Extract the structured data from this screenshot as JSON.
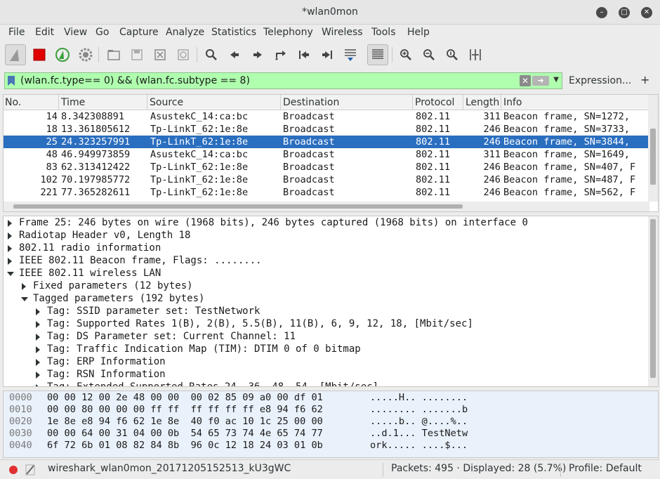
{
  "window": {
    "title": "*wlan0mon"
  },
  "menu": [
    "File",
    "Edit",
    "View",
    "Go",
    "Capture",
    "Analyze",
    "Statistics",
    "Telephony",
    "Wireless",
    "Tools",
    "Help"
  ],
  "filter": {
    "value": "(wlan.fc.type== 0) && (wlan.fc.subtype == 8)",
    "expression_label": "Expression...",
    "add_label": "+"
  },
  "packet_list": {
    "columns": [
      "No.",
      "Time",
      "Source",
      "Destination",
      "Protocol",
      "Length",
      "Info"
    ],
    "rows": [
      {
        "no": "14",
        "time": "8.342308891",
        "source": "AsustekC_14:ca:bc",
        "destination": "Broadcast",
        "protocol": "802.11",
        "length": "311",
        "info": "Beacon frame, SN=1272,",
        "selected": false
      },
      {
        "no": "18",
        "time": "13.361805612",
        "source": "Tp-LinkT_62:1e:8e",
        "destination": "Broadcast",
        "protocol": "802.11",
        "length": "246",
        "info": "Beacon frame, SN=3733,",
        "selected": false
      },
      {
        "no": "25",
        "time": "24.323257991",
        "source": "Tp-LinkT_62:1e:8e",
        "destination": "Broadcast",
        "protocol": "802.11",
        "length": "246",
        "info": "Beacon frame, SN=3844,",
        "selected": true
      },
      {
        "no": "48",
        "time": "46.949973859",
        "source": "AsustekC_14:ca:bc",
        "destination": "Broadcast",
        "protocol": "802.11",
        "length": "311",
        "info": "Beacon frame, SN=1649,",
        "selected": false
      },
      {
        "no": "83",
        "time": "62.313412422",
        "source": "Tp-LinkT_62:1e:8e",
        "destination": "Broadcast",
        "protocol": "802.11",
        "length": "246",
        "info": "Beacon frame, SN=407, F",
        "selected": false
      },
      {
        "no": "102",
        "time": "70.197985772",
        "source": "Tp-LinkT_62:1e:8e",
        "destination": "Broadcast",
        "protocol": "802.11",
        "length": "246",
        "info": "Beacon frame, SN=487, F",
        "selected": false
      },
      {
        "no": "221",
        "time": "77.365282611",
        "source": "Tp-LinkT_62:1e:8e",
        "destination": "Broadcast",
        "protocol": "802.11",
        "length": "246",
        "info": "Beacon frame, SN=562, F",
        "selected": false
      }
    ]
  },
  "details": [
    {
      "text": "Frame 25: 246 bytes on wire (1968 bits), 246 bytes captured (1968 bits) on interface 0",
      "level": 0,
      "expanded": false
    },
    {
      "text": "Radiotap Header v0, Length 18",
      "level": 0,
      "expanded": false
    },
    {
      "text": "802.11 radio information",
      "level": 0,
      "expanded": false
    },
    {
      "text": "IEEE 802.11 Beacon frame, Flags: ........",
      "level": 0,
      "expanded": false
    },
    {
      "text": "IEEE 802.11 wireless LAN",
      "level": 0,
      "expanded": true
    },
    {
      "text": "Fixed parameters (12 bytes)",
      "level": 1,
      "expanded": false
    },
    {
      "text": "Tagged parameters (192 bytes)",
      "level": 1,
      "expanded": true
    },
    {
      "text": "Tag: SSID parameter set: TestNetwork",
      "level": 2,
      "expanded": false
    },
    {
      "text": "Tag: Supported Rates 1(B), 2(B), 5.5(B), 11(B), 6, 9, 12, 18, [Mbit/sec]",
      "level": 2,
      "expanded": false
    },
    {
      "text": "Tag: DS Parameter set: Current Channel: 11",
      "level": 2,
      "expanded": false
    },
    {
      "text": "Tag: Traffic Indication Map (TIM): DTIM 0 of 0 bitmap",
      "level": 2,
      "expanded": false
    },
    {
      "text": "Tag: ERP Information",
      "level": 2,
      "expanded": false
    },
    {
      "text": "Tag: RSN Information",
      "level": 2,
      "expanded": false
    },
    {
      "text": "Tag: Extended Supported Rates 24, 36, 48, 54, [Mbit/sec]",
      "level": 2,
      "expanded": false
    }
  ],
  "hex": [
    {
      "offset": "0000",
      "bytes": "00 00 12 00 2e 48 00 00  00 02 85 09 a0 00 df 01",
      "ascii": ".....H.. ........"
    },
    {
      "offset": "0010",
      "bytes": "00 00 80 00 00 00 ff ff  ff ff ff ff e8 94 f6 62",
      "ascii": "........ .......b"
    },
    {
      "offset": "0020",
      "bytes": "1e 8e e8 94 f6 62 1e 8e  40 f0 ac 10 1c 25 00 00",
      "ascii": ".....b.. @....%.."
    },
    {
      "offset": "0030",
      "bytes": "00 00 64 00 31 04 00 0b  54 65 73 74 4e 65 74 77",
      "ascii": "..d.1... TestNetw"
    },
    {
      "offset": "0040",
      "bytes": "6f 72 6b 01 08 82 84 8b  96 0c 12 18 24 03 01 0b",
      "ascii": "ork..... ....$..."
    }
  ],
  "status": {
    "file": "wireshark_wlan0mon_20171205152513_kU3gWC",
    "packets": "Packets: 495 · Displayed: 28 (5.7%)",
    "profile": "Profile: Default"
  },
  "colors": {
    "filter_ok_bg": "#afffaf",
    "selection": "#2a6ebf",
    "hex_bg": "#e9f1fa",
    "record_red": "#e00000"
  }
}
